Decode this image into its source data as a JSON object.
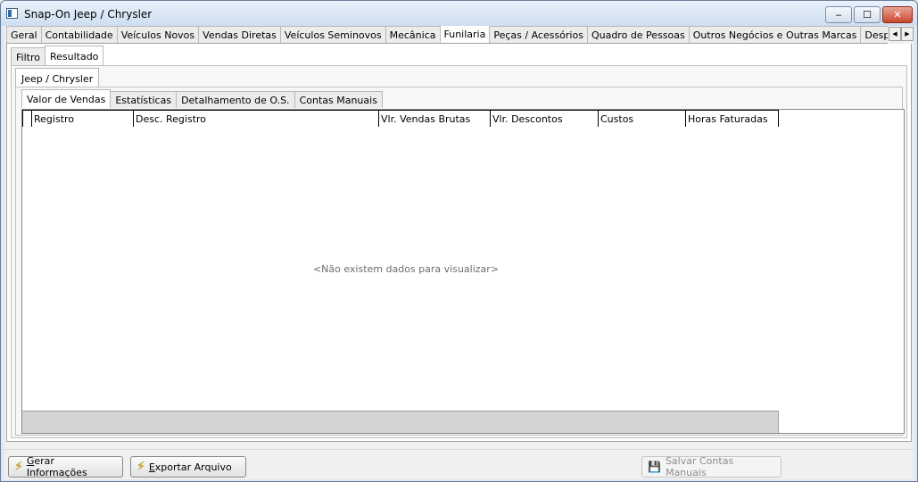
{
  "window": {
    "title": "Snap-On Jeep / Chrysler",
    "minimize_label": "‒",
    "maximize_label": "☐",
    "close_label": "✕"
  },
  "main_tabs": [
    "Geral",
    "Contabilidade",
    "Veículos Novos",
    "Vendas Diretas",
    "Veículos Seminovos",
    "Mecânica",
    "Funilaria",
    "Peças / Acessórios",
    "Quadro de Pessoas",
    "Outros Negócios e Outras Marcas",
    "Despesas Gerais por D"
  ],
  "main_tabs_active": "Funilaria",
  "tab_scroll": {
    "left": "◀",
    "right": "▶"
  },
  "sub_tabs": [
    "Filtro",
    "Resultado"
  ],
  "sub_tabs_active": "Resultado",
  "brand_tab": "Jeep / Chrysler",
  "detail_tabs": [
    "Valor de Vendas",
    "Estatísticas",
    "Detalhamento de O.S.",
    "Contas Manuais"
  ],
  "detail_tabs_active": "Valor de Vendas",
  "grid": {
    "columns": [
      "Registro",
      "Desc. Registro",
      "Vlr. Vendas Brutas",
      "Vlr. Descontos",
      "Custos",
      "Horas Faturadas"
    ],
    "empty_message": "<Não existem dados para visualizar>"
  },
  "buttons": {
    "gerar_prefix": "G",
    "gerar_rest": "erar Informações",
    "exportar_prefix": "E",
    "exportar_rest": "xportar Arquivo",
    "salvar": "Salvar Contas Manuais"
  }
}
